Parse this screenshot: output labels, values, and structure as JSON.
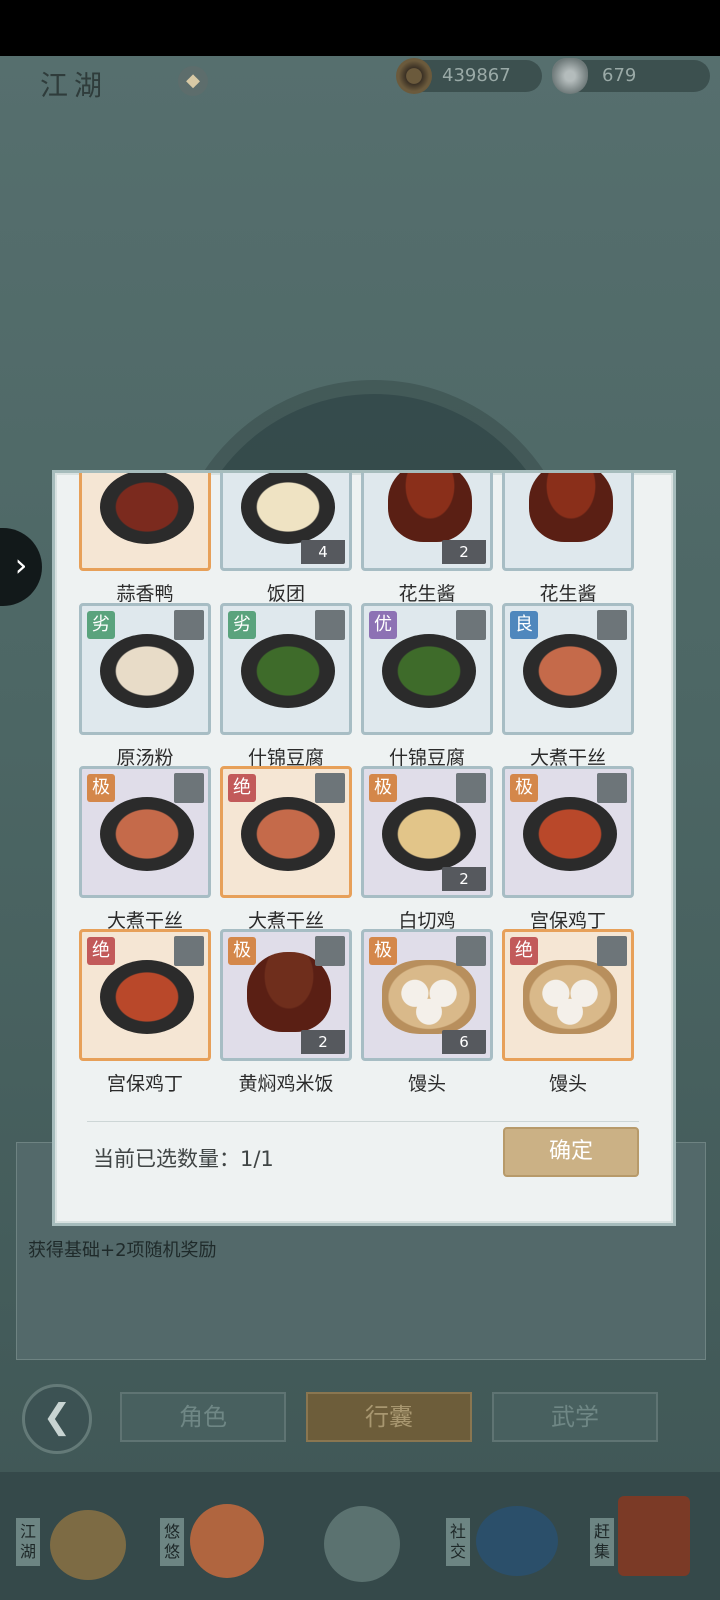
{
  "header": {
    "title": "江湖",
    "coins": "439867",
    "silver": "679"
  },
  "background": {
    "reward_text": "获得基础+2项随机奖励"
  },
  "nav": {
    "tabs": [
      "角色",
      "行囊",
      "武学"
    ],
    "active_index": 1
  },
  "dock": {
    "items": [
      "江湖",
      "悠悠",
      "社交",
      "赶集"
    ]
  },
  "modal": {
    "items": [
      {
        "name": "蒜香鸭",
        "grade": "",
        "count": "",
        "style": "orange",
        "food": "#7b2a1e",
        "kind": "plate"
      },
      {
        "name": "饭团",
        "grade": "",
        "count": "4",
        "style": "blue",
        "food": "#efe3c3",
        "kind": "plate"
      },
      {
        "name": "花生酱",
        "grade": "",
        "count": "2",
        "style": "blue",
        "food": "#8a2f1a",
        "kind": "bowl"
      },
      {
        "name": "花生酱",
        "grade": "",
        "count": "",
        "style": "blue",
        "food": "#8a2f1a",
        "kind": "bowl"
      },
      {
        "name": "原汤粉",
        "grade": "劣",
        "count": "",
        "style": "blue",
        "food": "#e8dcc8",
        "kind": "plate",
        "badge": "g"
      },
      {
        "name": "什锦豆腐",
        "grade": "劣",
        "count": "",
        "style": "blue",
        "food": "#3e6b2a",
        "kind": "plate",
        "badge": "g"
      },
      {
        "name": "什锦豆腐",
        "grade": "优",
        "count": "",
        "style": "blue",
        "food": "#3e6b2a",
        "kind": "plate",
        "badge": "p"
      },
      {
        "name": "大煮干丝",
        "grade": "良",
        "count": "",
        "style": "blue",
        "food": "#c56a4a",
        "kind": "plate",
        "badge": "b"
      },
      {
        "name": "大煮干丝",
        "grade": "极",
        "count": "",
        "style": "purple",
        "food": "#c56a4a",
        "kind": "plate",
        "badge": "o"
      },
      {
        "name": "大煮干丝",
        "grade": "绝",
        "count": "",
        "style": "orange",
        "food": "#c56a4a",
        "kind": "plate",
        "badge": "r"
      },
      {
        "name": "白切鸡",
        "grade": "极",
        "count": "2",
        "style": "purple",
        "food": "#e2c589",
        "kind": "plate",
        "badge": "o"
      },
      {
        "name": "宫保鸡丁",
        "grade": "极",
        "count": "",
        "style": "purple",
        "food": "#b9482a",
        "kind": "plate",
        "badge": "o"
      },
      {
        "name": "宫保鸡丁",
        "grade": "绝",
        "count": "",
        "style": "orange",
        "food": "#b9482a",
        "kind": "plate",
        "badge": "r"
      },
      {
        "name": "黄焖鸡米饭",
        "grade": "极",
        "count": "2",
        "style": "purple",
        "food": "#6f2e1c",
        "kind": "bowl",
        "badge": "o"
      },
      {
        "name": "馒头",
        "grade": "极",
        "count": "6",
        "style": "purple",
        "food": "#f4f0ea",
        "kind": "steam",
        "badge": "o"
      },
      {
        "name": "馒头",
        "grade": "绝",
        "count": "",
        "style": "orange",
        "food": "#f4f0ea",
        "kind": "steam",
        "badge": "r"
      }
    ],
    "selected_label": "当前已选数量：",
    "selected_value": "1/1",
    "confirm_label": "确定"
  }
}
